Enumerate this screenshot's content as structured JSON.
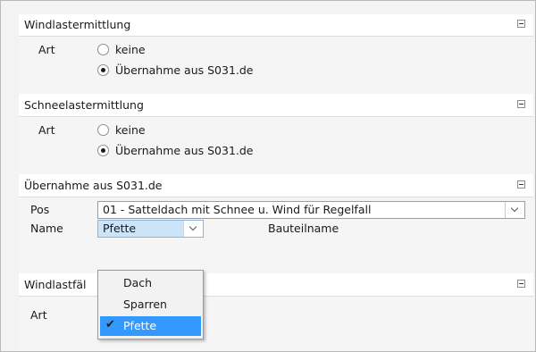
{
  "sections": {
    "wind": {
      "title": "Windlastermittlung",
      "art_label": "Art",
      "options": [
        "keine",
        "Übernahme aus S031.de"
      ],
      "selected": "Übernahme aus S031.de"
    },
    "schnee": {
      "title": "Schneelastermittlung",
      "art_label": "Art",
      "options": [
        "keine",
        "Übernahme aus S031.de"
      ],
      "selected": "Übernahme aus S031.de"
    },
    "uebernahme": {
      "title": "Übernahme aus S031.de",
      "pos_label": "Pos",
      "pos_value": "01 - Satteldach mit Schnee u. Wind für Regelfall",
      "name_label": "Name",
      "name_value": "Pfette",
      "bauteilname_label": "Bauteilname"
    },
    "windlastfaelle": {
      "title": "Windlastfäl",
      "art_label": "Art"
    }
  },
  "dropdown": {
    "items": [
      "Dach",
      "Sparren",
      "Pfette"
    ],
    "selected": "Pfette"
  },
  "icons": {
    "collapse": "minus-box-icon",
    "dropdown": "chevron-down-icon",
    "check": "check-icon"
  },
  "colors": {
    "selection_blue": "#3399ff",
    "active_field": "#cce4f7"
  }
}
